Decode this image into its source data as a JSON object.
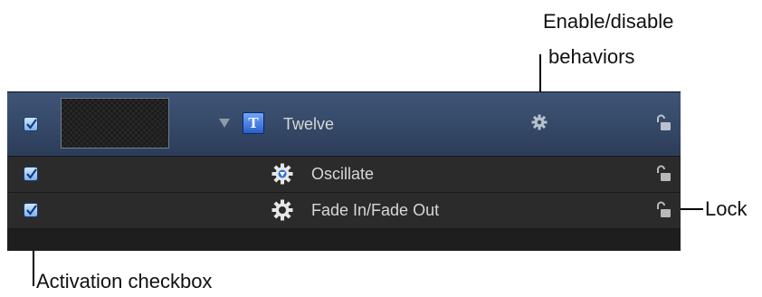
{
  "callouts": {
    "enable_behaviors_line1": "Enable/disable",
    "enable_behaviors_line2": "behaviors",
    "lock": "Lock",
    "activation_checkbox": "Activation checkbox"
  },
  "layers": {
    "main": {
      "name": "Twelve",
      "type_icon": "T",
      "enabled": true,
      "locked": false
    },
    "behaviors": [
      {
        "name": "Oscillate",
        "enabled": true,
        "locked": false,
        "icon": "oscillate-gear-icon"
      },
      {
        "name": "Fade In/Fade Out",
        "enabled": true,
        "locked": false,
        "icon": "gear-icon"
      }
    ]
  },
  "colors": {
    "selected_row": "#3f5577",
    "panel_bg": "#1e1e1e",
    "checkbox_fill": "#8fbdf2",
    "text_icon": "#4a86e8"
  }
}
